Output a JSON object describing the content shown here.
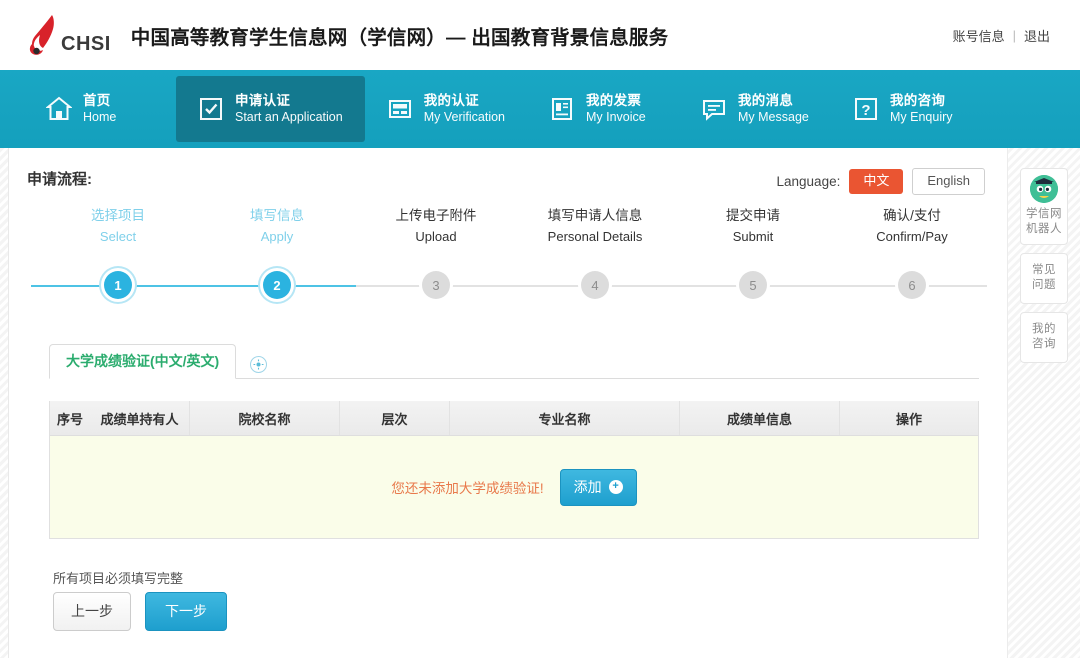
{
  "header": {
    "logo_text": "CHSI",
    "logo_icon": "chsi-flame-logo",
    "site_title": "中国高等教育学生信息网（学信网）— 出国教育背景信息服务",
    "account_link": "账号信息",
    "separator": "|",
    "logout_link": "退出"
  },
  "nav": {
    "items": [
      {
        "cn": "首页",
        "en": "Home",
        "icon": "home-icon",
        "active": false
      },
      {
        "cn": "申请认证",
        "en": "Start an Application",
        "icon": "checkbox-icon",
        "active": true
      },
      {
        "cn": "我的认证",
        "en": "My Verification",
        "icon": "verification-icon",
        "active": false
      },
      {
        "cn": "我的发票",
        "en": "My Invoice",
        "icon": "invoice-icon",
        "active": false
      },
      {
        "cn": "我的消息",
        "en": "My Message",
        "icon": "message-icon",
        "active": false
      },
      {
        "cn": "我的咨询",
        "en": "My Enquiry",
        "icon": "question-icon",
        "active": false
      }
    ]
  },
  "flow": {
    "title": "申请流程:",
    "language_label": "Language:",
    "lang_cn": "中文",
    "lang_en": "English",
    "lang_active": "中文",
    "accent_active": "#2bb3e0",
    "accent_cn_btn": "#ea5532",
    "steps": [
      {
        "num": "1",
        "cn": "选择项目",
        "en": "Select",
        "state": "done"
      },
      {
        "num": "2",
        "cn": "填写信息",
        "en": "Apply",
        "state": "done"
      },
      {
        "num": "3",
        "cn": "上传电子附件",
        "en": "Upload",
        "state": "todo"
      },
      {
        "num": "4",
        "cn": "填写申请人信息",
        "en": "Personal Details",
        "state": "todo"
      },
      {
        "num": "5",
        "cn": "提交申请",
        "en": "Submit",
        "state": "todo"
      },
      {
        "num": "6",
        "cn": "确认/支付",
        "en": "Confirm/Pay",
        "state": "todo"
      }
    ],
    "current_step": 2
  },
  "tabs": {
    "items": [
      {
        "label_main": "大学成绩验证",
        "label_sub": "(中文/英文)",
        "active": true
      }
    ],
    "add_icon": "add-circle-icon",
    "add_glyph": "✛"
  },
  "table": {
    "columns": [
      "序号",
      "成绩单持有人",
      "院校名称",
      "层次",
      "专业名称",
      "成绩单信息",
      "操作"
    ],
    "rows": [],
    "empty_message": "您还未添加大学成绩验证!",
    "empty_message_color": "#e8794b",
    "add_button_label": "添加",
    "add_button_icon": "plus-circle-icon",
    "body_background": "#fafde9"
  },
  "footer": {
    "note": "所有项目必须填写完整",
    "prev_button": "上一步",
    "next_button": "下一步"
  },
  "right_rail": {
    "items": [
      {
        "icon": "robot-avatar-icon",
        "line1": "学信网",
        "line2": "机器人"
      },
      {
        "icon": null,
        "line1": "常见",
        "line2": "问题"
      },
      {
        "icon": null,
        "line1": "我的",
        "line2": "咨询"
      }
    ]
  }
}
